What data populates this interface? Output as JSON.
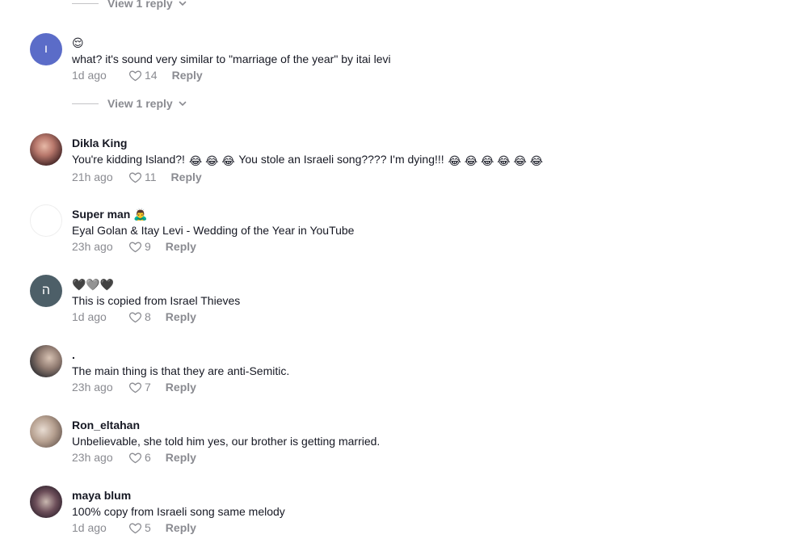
{
  "view_reply_label": "View 1 reply",
  "reply_label": "Reply",
  "comments": [
    {
      "username": "😌",
      "text": "what? it's sound very similar to \"marriage of the year\" by itai levi",
      "time": "1d ago",
      "likes": "14",
      "avatar_letter": "ı"
    },
    {
      "username": "Dikla King",
      "text_before": "You're kidding Island?!",
      "emoji_a": "😂 😂 😂",
      "text_mid": "You stole an Israeli song???? I'm dying!!!",
      "emoji_b": "😂 😂 😂 😂 😂 😂",
      "time": "21h ago",
      "likes": "11"
    },
    {
      "username": "Super man 🙇‍♂️",
      "text": "Eyal Golan & Itay Levi - Wedding of the Year in YouTube",
      "time": "23h ago",
      "likes": "9"
    },
    {
      "username": "🖤🩶🖤",
      "text": "This is copied from Israel Thieves",
      "time": "1d ago",
      "likes": "8",
      "avatar_letter": "ה"
    },
    {
      "username": ".",
      "text": "The main thing is that they are anti-Semitic.",
      "time": "23h ago",
      "likes": "7"
    },
    {
      "username": "Ron_eltahan",
      "text": "Unbelievable, she told him yes, our brother is getting married.",
      "time": "23h ago",
      "likes": "6"
    },
    {
      "username": "maya blum",
      "text": "100% copy from Israeli song same melody",
      "time": "1d ago",
      "likes": "5"
    }
  ]
}
